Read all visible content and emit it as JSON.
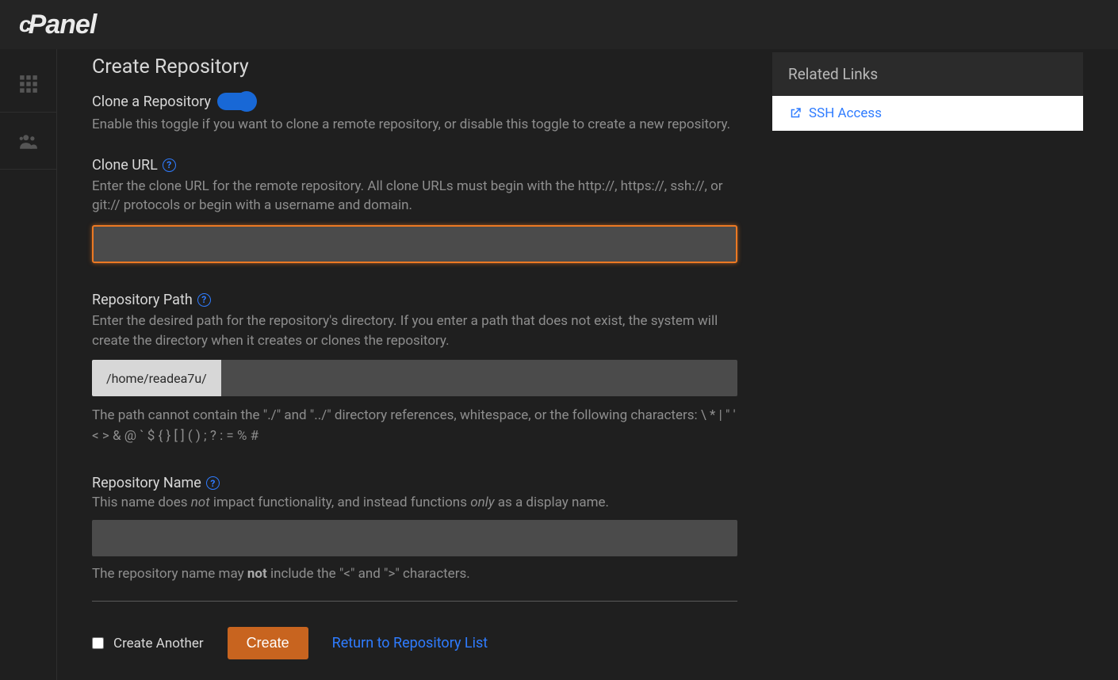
{
  "brand": "cPanel",
  "page": {
    "title": "Create Repository",
    "clone_toggle_label": "Clone a Repository",
    "clone_toggle_help": "Enable this toggle if you want to clone a remote repository, or disable this toggle to create a new repository.",
    "clone_url_label": "Clone URL",
    "clone_url_help": "Enter the clone URL for the remote repository. All clone URLs must begin with the http://, https://, ssh://, or git:// protocols or begin with a username and domain.",
    "clone_url_value": "",
    "repo_path_label": "Repository Path",
    "repo_path_help": "Enter the desired path for the repository's directory. If you enter a path that does not exist, the system will create the directory when it creates or clones the repository.",
    "repo_path_prefix": "/home/readea7u/",
    "repo_path_value": "",
    "repo_path_below": "The path cannot contain the \"./\" and \"../\" directory references, whitespace, or the following characters: \\ * | \" ' < > & @ ` $ { } [ ] ( ) ; ? : = % #",
    "repo_name_label": "Repository Name",
    "repo_name_help_pre": "This name does ",
    "repo_name_help_em1": "not",
    "repo_name_help_mid": " impact functionality, and instead functions ",
    "repo_name_help_em2": "only",
    "repo_name_help_post": " as a display name.",
    "repo_name_value": "",
    "repo_name_below_pre": "The repository name may ",
    "repo_name_below_strong": "not",
    "repo_name_below_post": " include the \"<\" and \">\" characters.",
    "create_another_label": "Create Another",
    "create_button": "Create",
    "return_link": "Return to Repository List"
  },
  "side": {
    "header": "Related Links",
    "link1": "SSH Access"
  }
}
